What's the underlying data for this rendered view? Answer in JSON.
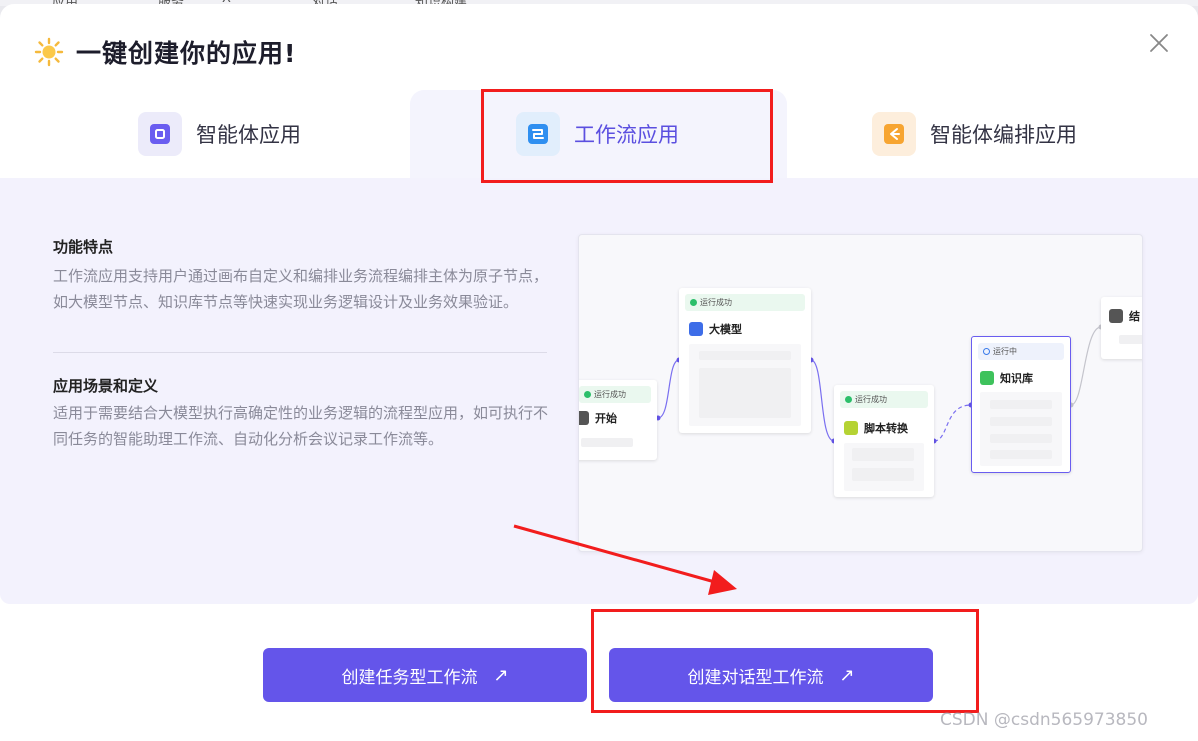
{
  "background": {
    "strip_items": [
      "应用",
      "服务",
      "X",
      "对话",
      "知识构建"
    ]
  },
  "modal": {
    "title": "一键创建你的应用!",
    "close_icon": "close-icon"
  },
  "tabs": [
    {
      "label": "智能体应用",
      "icon": "agent-app-icon"
    },
    {
      "label": "工作流应用",
      "icon": "workflow-app-icon"
    },
    {
      "label": "智能体编排应用",
      "icon": "agent-orchestration-icon"
    }
  ],
  "panel": {
    "feature_title": "功能特点",
    "feature_text": "工作流应用支持用户通过画布自定义和编排业务流程编排主体为原子节点，如大模型节点、知识库节点等快速实现业务逻辑设计及业务效果验证。",
    "scene_title": "应用场景和定义",
    "scene_text": "适用于需要结合大模型执行高确定性的业务逻辑的流程型应用，如可执行不同任务的智能助理工作流、自动化分析会议记录工作流等。"
  },
  "preview": {
    "nodes": {
      "start": {
        "status": "运行成功",
        "name": "开始"
      },
      "llm": {
        "status": "运行成功",
        "name": "大模型"
      },
      "script": {
        "status": "运行成功",
        "name": "脚本转换"
      },
      "kb": {
        "status": "运行中",
        "name": "知识库"
      },
      "end": {
        "name": "结"
      }
    }
  },
  "buttons": {
    "task_workflow": "创建任务型工作流",
    "chat_workflow": "创建对话型工作流",
    "arrow_glyph": "↗"
  },
  "watermark": "CSDN @csdn565973850",
  "colors": {
    "accent": "#6455ea",
    "annotation_red": "#f21d1d",
    "panel_bg": "#f3f2fd"
  }
}
